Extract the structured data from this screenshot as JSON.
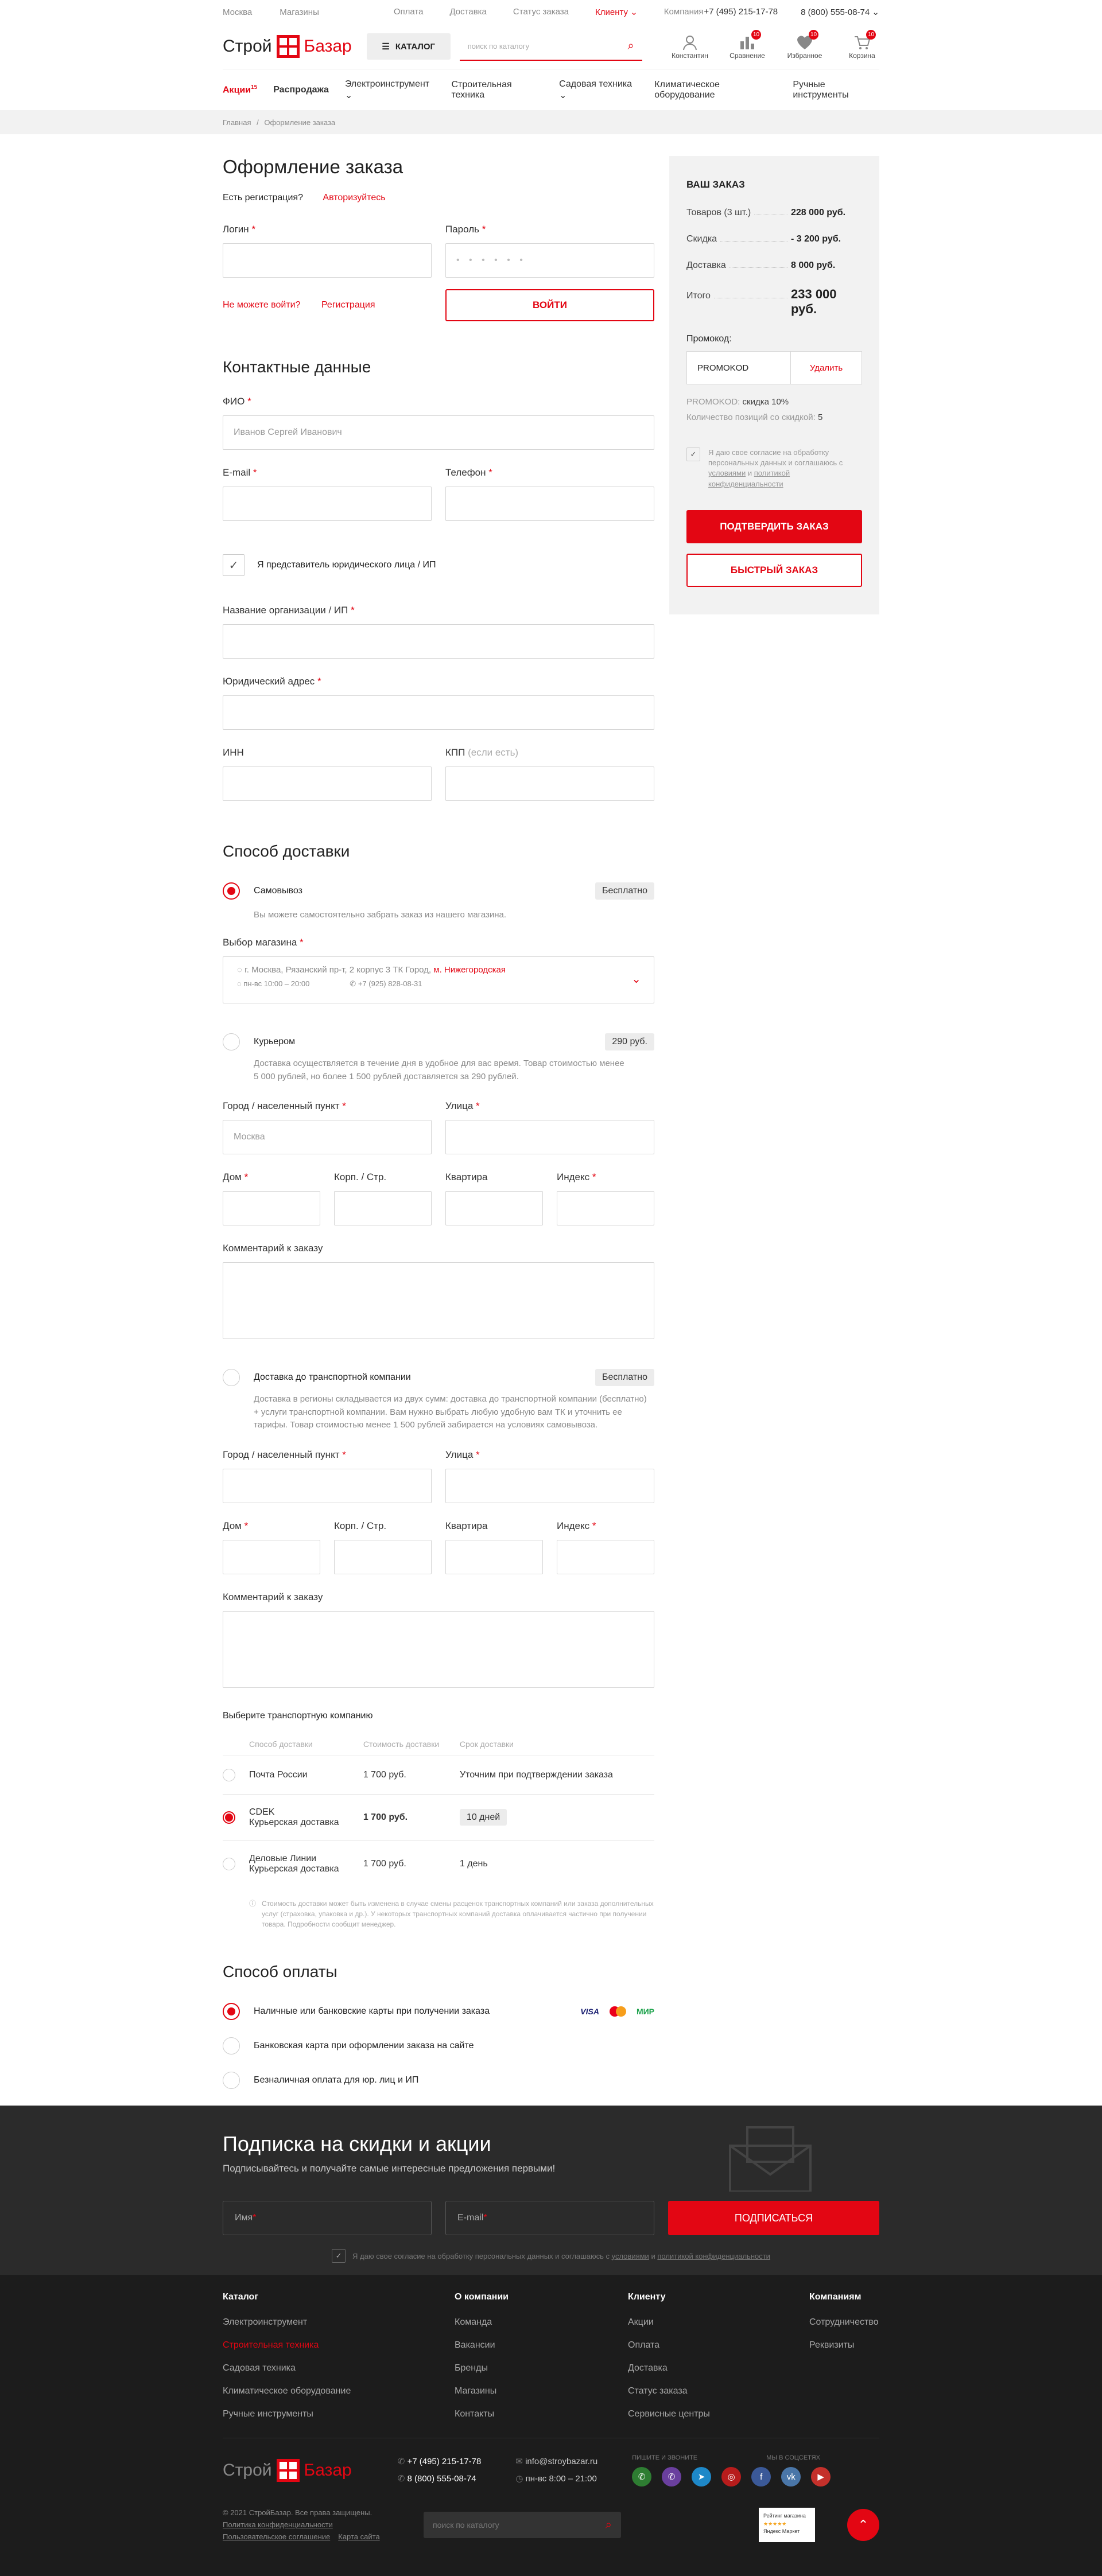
{
  "topbar": {
    "links_left": [
      "Москва",
      "Магазины"
    ],
    "links_mid": [
      "Оплата",
      "Доставка",
      "Статус заказа",
      "Клиенту",
      "Компания"
    ],
    "phone1": "+7 (495) 215-17-78",
    "phone2": "8 (800) 555-08-74"
  },
  "header": {
    "logo_left": "Строй",
    "logo_right": "Базар",
    "catalog": "КАТАЛОГ",
    "search_placeholder": "поиск по каталогу",
    "icons": [
      {
        "label": "Константин",
        "badge": ""
      },
      {
        "label": "Сравнение",
        "badge": "10"
      },
      {
        "label": "Избранное",
        "badge": "10"
      },
      {
        "label": "Корзина",
        "badge": "10"
      }
    ]
  },
  "nav": {
    "akcii": "Акции",
    "akcii_sup": "15",
    "items": [
      "Распродажа",
      "Электроинструмент",
      "Строительная техника",
      "Садовая техника",
      "Климатическое оборудование",
      "Ручные инструменты"
    ]
  },
  "crumbs": {
    "home": "Главная",
    "current": "Оформление заказа"
  },
  "order": {
    "title": "Оформление заказа",
    "have_account": "Есть регистрация?",
    "login_link": "Авторизуйтесь",
    "login_label": "Логин",
    "password_label": "Пароль",
    "password_mask": "• • • • • •",
    "cant_login": "Не можете войти?",
    "register": "Регистрация",
    "enter_btn": "ВОЙТИ"
  },
  "contacts": {
    "title": "Контактные данные",
    "fio_label": "ФИО",
    "fio_placeholder": "Иванов Сергей Иванович",
    "email_label": "E-mail",
    "phone_label": "Телефон",
    "legal_check": "Я представитель юридического лица / ИП",
    "org_label": "Название организации / ИП",
    "address_label": "Юридический адрес",
    "inn_label": "ИНН",
    "kpp_label": "КПП",
    "kpp_hint": "(если есть)"
  },
  "delivery": {
    "title": "Способ доставки",
    "pickup": "Самовывоз",
    "pickup_price": "Бесплатно",
    "pickup_desc": "Вы можете самостоятельно забрать заказ из нашего магазина.",
    "store_label": "Выбор магазина",
    "store_address": "г. Москва, Рязанский пр-т, 2 корпус 3 ТК Город,",
    "store_metro": "м. Нижегородская",
    "store_hours": "пн-вс 10:00 – 20:00",
    "store_phone": "+7 (925) 828-08-31",
    "courier": "Курьером",
    "courier_price": "290 руб.",
    "courier_desc": "Доставка осуществляется в течение дня в удобное для вас время. Товар стоимостью менее 5 000 рублей, но более 1 500 рублей доставляется за 290 рублей.",
    "city_label": "Город / населенный пункт",
    "city_placeholder": "Москва",
    "street_label": "Улица",
    "house_label": "Дом",
    "korp_label": "Корп. / Стр.",
    "flat_label": "Квартира",
    "index_label": "Индекс",
    "comment_label": "Комментарий к заказу",
    "tc": "Доставка до транспортной компании",
    "tc_price": "Бесплатно",
    "tc_desc": "Доставка в регионы складывается из двух сумм: доставка до транспортной компании (бесплатно) + услуги транспортной компании. Вам нужно выбрать любую удобную вам ТК и уточнить ее тарифы. Товар стоимостью менее 1 500 рублей забирается на условиях самовывоза.",
    "tc_choose": "Выберите транспортную компанию",
    "tc_headers": [
      "Способ доставки",
      "Стоимость доставки",
      "Срок доставки"
    ],
    "tc_rows": [
      {
        "name": "Почта России",
        "sub": "",
        "price": "1 700 руб.",
        "term": "Уточним при подтверждении заказа"
      },
      {
        "name": "CDEK",
        "sub": "Курьерская доставка",
        "price": "1 700 руб.",
        "term": "10 дней"
      },
      {
        "name": "Деловые Линии",
        "sub": "Курьерская доставка",
        "price": "1 700 руб.",
        "term": "1 день"
      }
    ],
    "tc_note": "Стоимость доставки может быть изменена в случае смены расценок транспортных компаний или заказа дополнительных услуг (страховка, упаковка и др.). У некоторых транспортных компаний доставка оплачивается частично при получении товара. Подробности сообщит менеджер."
  },
  "payment": {
    "title": "Способ оплаты",
    "options": [
      "Наличные или банковские карты при получении заказа",
      "Банковская карта при оформлении заказа на сайте",
      "Безналичная оплата для юр. лиц и ИП"
    ],
    "cards": [
      "VISA",
      "МИР"
    ]
  },
  "summary": {
    "title": "ВАШ ЗАКАЗ",
    "lines": [
      {
        "k": "Товаров (3 шт.)",
        "v": "228 000 руб."
      },
      {
        "k": "Скидка",
        "v": "- 3 200 руб."
      },
      {
        "k": "Доставка",
        "v": "8 000 руб."
      }
    ],
    "total_label": "Итого",
    "total": "233 000 руб.",
    "promo_label": "Промокод:",
    "promo_value": "PROMOKOD",
    "promo_delete": "Удалить",
    "promo_info1_k": "PROMOKOD:",
    "promo_info1_v": "скидка 10%",
    "promo_info2_k": "Количество позиций со скидкой:",
    "promo_info2_v": "5",
    "agree": "Я даю свое согласие на обработку персональных данных и соглашаюсь с",
    "agree_link1": "условиями",
    "agree_and": "и",
    "agree_link2": "политикой конфиденциальности",
    "confirm": "ПОДТВЕРДИТЬ ЗАКАЗ",
    "quick": "БЫСТРЫЙ ЗАКАЗ"
  },
  "subscribe": {
    "title": "Подписка на скидки и акции",
    "subtitle": "Подписывайтесь и получайте самые интересные предложения первыми!",
    "name_placeholder": "Имя",
    "email_placeholder": "E-mail",
    "button": "ПОДПИСАТЬСЯ",
    "agree": "Я даю свое согласие на обработку персональных данных и соглашаюсь с",
    "agree_link1": "условиями",
    "agree_and": "и",
    "agree_link2": "политикой конфиденциальности"
  },
  "footer": {
    "cols": [
      {
        "title": "Каталог",
        "links": [
          "Электроинструмент",
          "Строительная техника",
          "Садовая техника",
          "Климатическое оборудование",
          "Ручные инструменты"
        ]
      },
      {
        "title": "О компании",
        "links": [
          "Команда",
          "Вакансии",
          "Бренды",
          "Магазины",
          "Контакты"
        ]
      },
      {
        "title": "Клиенту",
        "links": [
          "Акции",
          "Оплата",
          "Доставка",
          "Статус заказа",
          "Сервисные центры"
        ]
      },
      {
        "title": "Компаниям",
        "links": [
          "Сотрудничество",
          "Реквизиты"
        ]
      }
    ],
    "phone1": "+7 (495) 215-17-78",
    "phone2": "8 (800) 555-08-74",
    "email": "info@stroybazar.ru",
    "hours": "пн-вс 8:00 – 21:00",
    "write_us": "ПИШИТЕ И ЗВОНИТЕ",
    "follow_us": "МЫ В СОЦСЕТЯХ",
    "copyright": "© 2021 СтройБазар. Все права защищены.",
    "policy": "Политика конфиденциальности",
    "agreement": "Пользовательское соглашение",
    "sitemap": "Карта сайта",
    "search_placeholder": "поиск по каталогу",
    "rating_title": "Рейтинг магазина",
    "rating_stars": "★★★★★",
    "rating_source": "Яндекс Маркет"
  },
  "colors": {
    "accent": "#e30613",
    "dark": "#2b2b2b",
    "darker": "#1c1c1c"
  }
}
